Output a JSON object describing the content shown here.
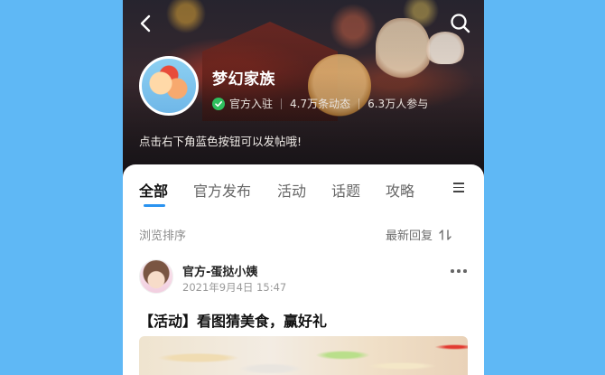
{
  "header": {
    "back_icon": "chevron-left-icon",
    "search_icon": "search-icon"
  },
  "group": {
    "name": "梦幻家族",
    "official_label": "官方入驻",
    "posts_count": "4.7万条动态",
    "participants": "6.3万人参与",
    "notice": "点击右下角蓝色按钮可以发帖哦!"
  },
  "tabs": [
    {
      "label": "全部",
      "active": true
    },
    {
      "label": "官方发布",
      "active": false
    },
    {
      "label": "活动",
      "active": false
    },
    {
      "label": "话题",
      "active": false
    },
    {
      "label": "攻略",
      "active": false
    }
  ],
  "sort": {
    "left_label": "浏览排序",
    "right_label": "最新回复"
  },
  "post": {
    "author": "官方-蛋挞小姨",
    "time": "2021年9月4日 15:47",
    "title": "【活动】看图猜美食，赢好礼"
  },
  "colors": {
    "accent": "#2a93f0",
    "verified": "#2fbf5e",
    "background": "#5fb8f5"
  }
}
